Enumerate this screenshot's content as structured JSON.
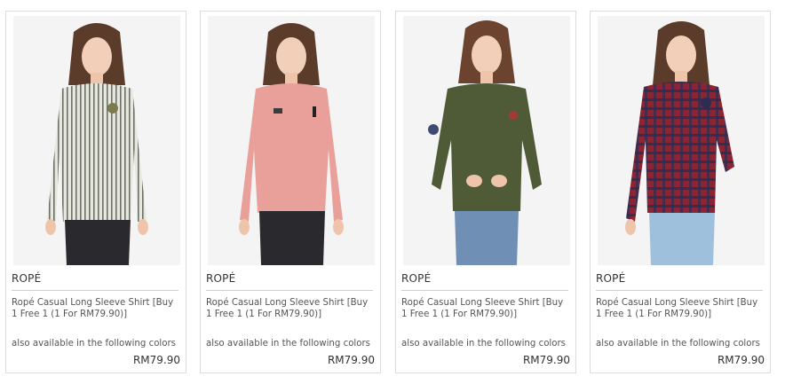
{
  "products": [
    {
      "brand": "ROPÉ",
      "name": "Ropé Casual Long Sleeve Shirt [Buy 1 Free 1 (1 For RM79.90)]",
      "availability": "also available in the following colors",
      "price": "RM79.90",
      "shirt_color": "#dfe1d8",
      "pants_color": "#2a2a2e",
      "pattern": "stripes"
    },
    {
      "brand": "ROPÉ",
      "name": "Ropé Casual Long Sleeve Shirt [Buy 1 Free 1 (1 For RM79.90)]",
      "availability": "also available in the following colors",
      "price": "RM79.90",
      "shirt_color": "#e9a09a",
      "pants_color": "#2a2a2e",
      "pattern": "plain"
    },
    {
      "brand": "ROPÉ",
      "name": "Ropé Casual Long Sleeve Shirt [Buy 1 Free 1 (1 For RM79.90)]",
      "availability": "also available in the following colors",
      "price": "RM79.90",
      "shirt_color": "#4f5a36",
      "pants_color": "#6f8fb5",
      "pattern": "plain"
    },
    {
      "brand": "ROPÉ",
      "name": "Ropé Casual Long Sleeve Shirt [Buy 1 Free 1 (1 For RM79.90)]",
      "availability": "also available in the following colors",
      "price": "RM79.90",
      "shirt_color": "#8c2531",
      "pants_color": "#9fc0dc",
      "pattern": "plaid"
    }
  ]
}
